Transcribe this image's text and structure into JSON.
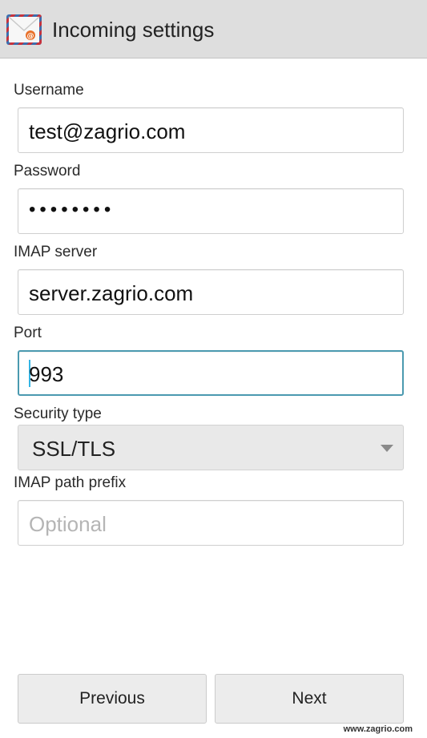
{
  "action_bar": {
    "title": "Incoming settings",
    "icon": "email-envelope-icon"
  },
  "fields": {
    "username": {
      "label": "Username",
      "value": "test@zagrio.com"
    },
    "password": {
      "label": "Password",
      "value": "••••••••"
    },
    "imap_server": {
      "label": "IMAP server",
      "value": "server.zagrio.com"
    },
    "port": {
      "label": "Port",
      "value": "993"
    },
    "security_type": {
      "label": "Security type",
      "value": "SSL/TLS"
    },
    "imap_path_prefix": {
      "label": "IMAP path prefix",
      "value": "",
      "placeholder": "Optional"
    }
  },
  "buttons": {
    "previous": "Previous",
    "next": "Next"
  },
  "watermark": "www.zagrio.com",
  "colors": {
    "action_bar_bg": "#dedede",
    "focus_border": "#4b9ab0",
    "caret": "#33b5e5",
    "envelope_border_red": "#c8323c",
    "envelope_border_blue": "#3a6fb0"
  }
}
